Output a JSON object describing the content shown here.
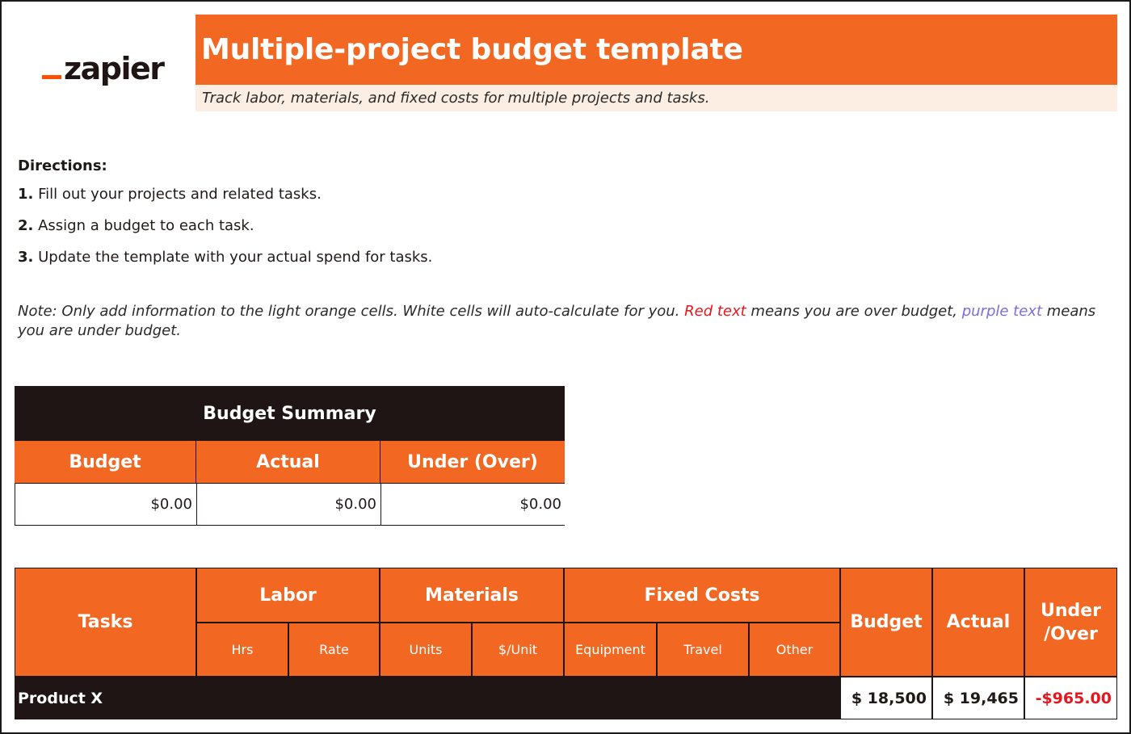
{
  "logo": {
    "text": "zapier"
  },
  "header": {
    "title": "Multiple-project budget template",
    "subtitle": "Track labor, materials, and fixed costs for multiple projects and tasks."
  },
  "directions": {
    "title": "Directions:",
    "items": [
      {
        "num": "1.",
        "text": "Fill out your projects and related tasks."
      },
      {
        "num": "2.",
        "text": "Assign a budget to each task."
      },
      {
        "num": "3.",
        "text": "Update the template with your actual spend for tasks."
      }
    ]
  },
  "note": {
    "part1": "Note: Only add information to the light orange cells. White cells will auto-calculate for you. ",
    "red": "Red text",
    "part2": " means you are over budget, ",
    "purple": "purple text",
    "part3": " means you are under budget."
  },
  "summary": {
    "title": "Budget Summary",
    "columns": [
      "Budget",
      "Actual",
      "Under (Over)"
    ],
    "values": [
      "$0.00",
      "$0.00",
      "$0.00"
    ]
  },
  "table": {
    "tasks": "Tasks",
    "labor": "Labor",
    "materials": "Materials",
    "fixed": "Fixed Costs",
    "budget": "Budget",
    "actual": "Actual",
    "under_over": "Under /Over",
    "sub": {
      "hrs": "Hrs",
      "rate": "Rate",
      "units": "Units",
      "per_unit": "$/Unit",
      "equipment": "Equipment",
      "travel": "Travel",
      "other": "Other"
    },
    "row": {
      "name": "Product X",
      "budget": "$ 18,500",
      "actual": "$ 19,465",
      "diff": "-$965.00"
    }
  },
  "colors": {
    "accent": "#f26722",
    "dark": "#201515",
    "subtitle_bg": "#fdeee3",
    "over": "#e8161c",
    "under": "#7b6ee0"
  }
}
